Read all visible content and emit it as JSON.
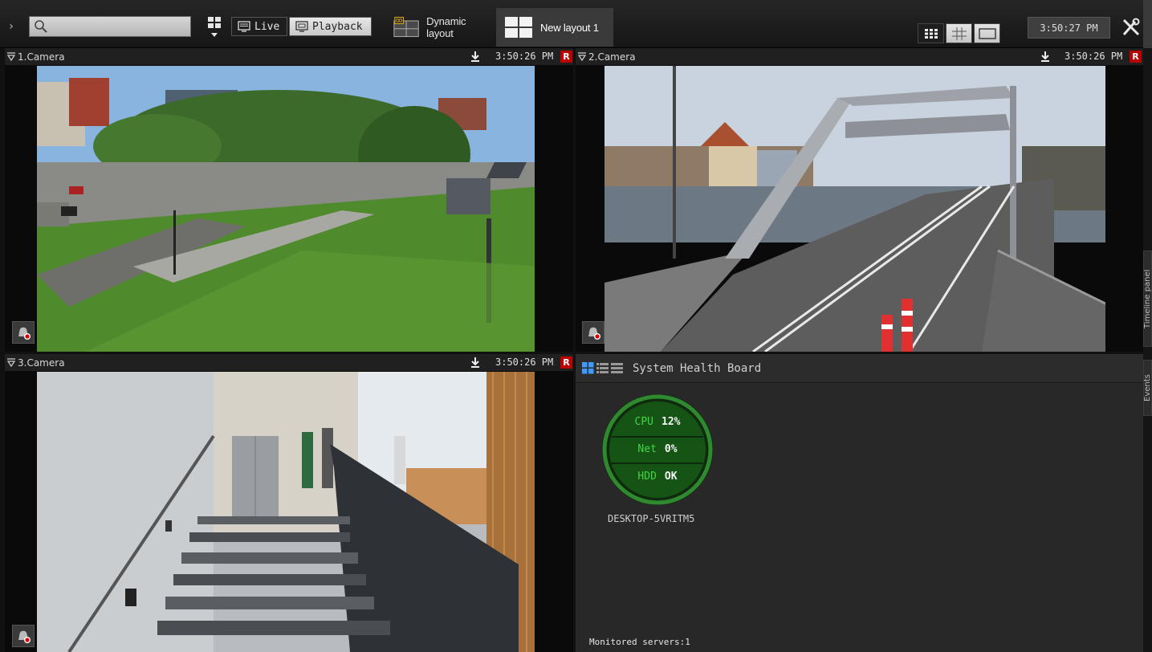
{
  "search": {
    "placeholder": ""
  },
  "modes": {
    "live": "Live",
    "playback": "Playback"
  },
  "layouts": {
    "dynamic": "Dynamic layout",
    "current": "New layout 1"
  },
  "clock": "3:50:27 PM",
  "cameras": [
    {
      "name": "1.Camera",
      "time": "3:50:26 PM",
      "rec": "R"
    },
    {
      "name": "2.Camera",
      "time": "3:50:26 PM",
      "rec": "R"
    },
    {
      "name": "3.Camera",
      "time": "3:50:26 PM",
      "rec": "R"
    }
  ],
  "health": {
    "title": "System Health Board",
    "metrics": [
      {
        "label": "CPU",
        "value": "12%"
      },
      {
        "label": "Net",
        "value": "0%"
      },
      {
        "label": "HDD",
        "value": "OK"
      }
    ],
    "server": "DESKTOP-5VRITM5",
    "monitored": "Monitored servers:1"
  },
  "side_tabs": {
    "timeline": "Timeline panel",
    "events": "Events"
  },
  "colors": {
    "accent_green": "#42d542",
    "gauge_ring": "#2f8a2f",
    "rec_red": "#bb0000",
    "tab_active": "#3a3a3a"
  }
}
